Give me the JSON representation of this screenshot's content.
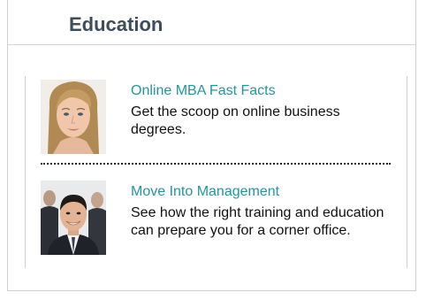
{
  "header": {
    "title": "Education"
  },
  "articles": [
    {
      "title": "Online MBA Fast Facts",
      "description": "Get the scoop on online business degrees.",
      "image": "woman-portrait"
    },
    {
      "title": "Move Into Management",
      "description": "See how the right training and education can prepare you for a corner office.",
      "image": "man-portrait"
    }
  ],
  "colors": {
    "title": "#3d4d5c",
    "link": "#23969b",
    "border": "#cfcfcf"
  }
}
